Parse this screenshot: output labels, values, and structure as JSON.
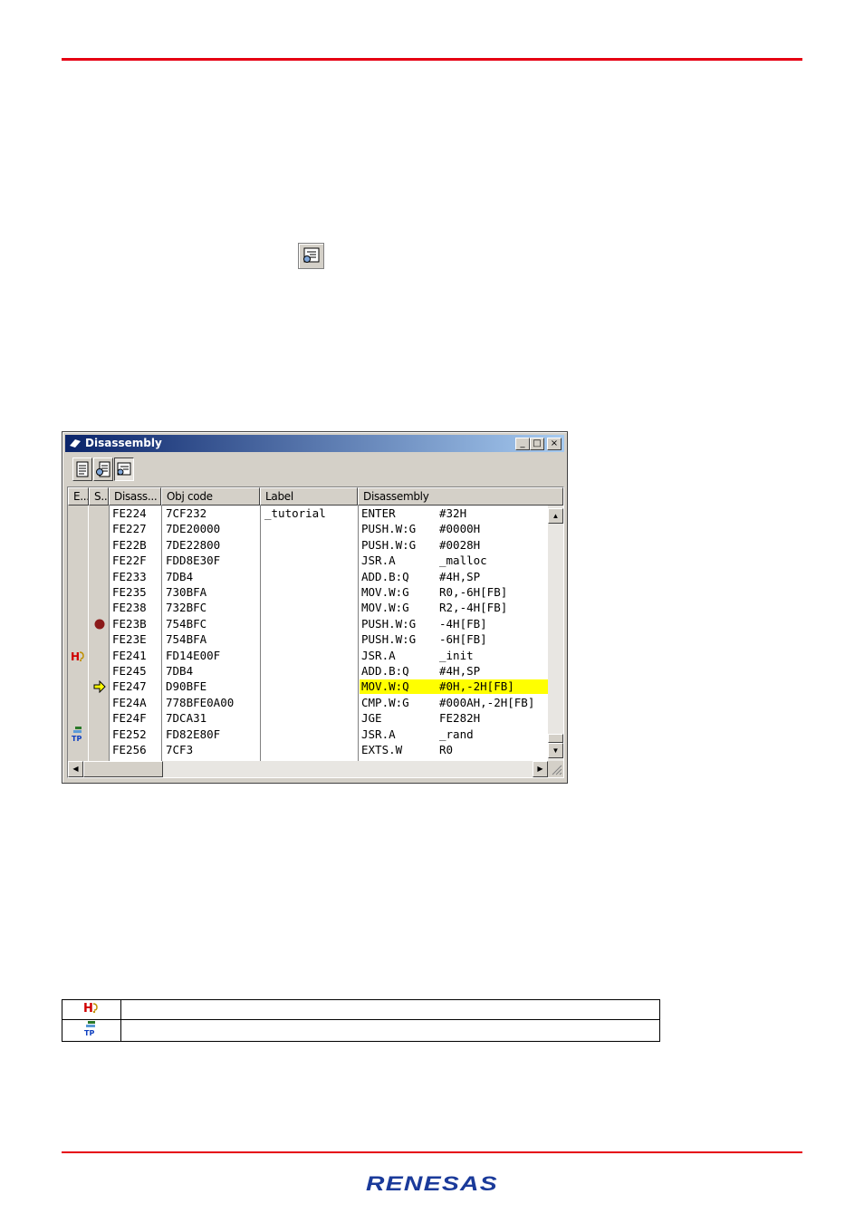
{
  "window": {
    "title": "Disassembly",
    "controls": {
      "minimize": "_",
      "maximize": "□",
      "close": "×"
    }
  },
  "toolbar": {
    "buttons": [
      {
        "icon": "source-view-icon",
        "pressed": false
      },
      {
        "icon": "mixed-view-icon",
        "pressed": false
      },
      {
        "icon": "disassembly-view-icon",
        "pressed": true
      }
    ]
  },
  "columns": [
    "E...",
    "S..",
    "Disass...",
    "Obj code",
    "Label",
    "Disassembly"
  ],
  "rows": [
    {
      "addr": "FE224",
      "obj": "7CF232",
      "label": "_tutorial",
      "mnemonic": "ENTER",
      "operand": "#32H"
    },
    {
      "addr": "FE227",
      "obj": "7DE20000",
      "label": "",
      "mnemonic": "PUSH.W:G",
      "operand": "#0000H"
    },
    {
      "addr": "FE22B",
      "obj": "7DE22800",
      "label": "",
      "mnemonic": "PUSH.W:G",
      "operand": "#0028H"
    },
    {
      "addr": "FE22F",
      "obj": "FDD8E30F",
      "label": "",
      "mnemonic": "JSR.A",
      "operand": "_malloc"
    },
    {
      "addr": "FE233",
      "obj": "7DB4",
      "label": "",
      "mnemonic": "ADD.B:Q",
      "operand": "#4H,SP"
    },
    {
      "addr": "FE235",
      "obj": "730BFA",
      "label": "",
      "mnemonic": "MOV.W:G",
      "operand": "R0,-6H[FB]"
    },
    {
      "addr": "FE238",
      "obj": "732BFC",
      "label": "",
      "mnemonic": "MOV.W:G",
      "operand": "R2,-4H[FB]"
    },
    {
      "addr": "FE23B",
      "obj": "754BFC",
      "label": "",
      "mnemonic": "PUSH.W:G",
      "operand": "-4H[FB]"
    },
    {
      "addr": "FE23E",
      "obj": "754BFA",
      "label": "",
      "mnemonic": "PUSH.W:G",
      "operand": "-6H[FB]"
    },
    {
      "addr": "FE241",
      "obj": "FD14E00F",
      "label": "",
      "mnemonic": "JSR.A",
      "operand": "_init"
    },
    {
      "addr": "FE245",
      "obj": "7DB4",
      "label": "",
      "mnemonic": "ADD.B:Q",
      "operand": "#4H,SP"
    },
    {
      "addr": "FE247",
      "obj": "D90BFE",
      "label": "",
      "mnemonic": "MOV.W:Q",
      "operand": "#0H,-2H[FB]"
    },
    {
      "addr": "FE24A",
      "obj": "778BFE0A00",
      "label": "",
      "mnemonic": "CMP.W:G",
      "operand": "#000AH,-2H[FB]"
    },
    {
      "addr": "FE24F",
      "obj": "7DCA31",
      "label": "",
      "mnemonic": "JGE",
      "operand": "FE282H"
    },
    {
      "addr": "FE252",
      "obj": "FD82E80F",
      "label": "",
      "mnemonic": "JSR.A",
      "operand": "_rand"
    },
    {
      "addr": "FE256",
      "obj": "7CF3",
      "label": "",
      "mnemonic": "EXTS.W",
      "operand": "R0"
    }
  ],
  "markers": {
    "breakpoint_row": 7,
    "pc_row": 11,
    "event_h_row": 9,
    "event_tp_row": 14
  },
  "colors": {
    "accent_red": "#e60012",
    "highlight": "#ffff00",
    "title_start": "#0a246a",
    "title_end": "#a6caf0",
    "breakpoint": "#8b1a1a"
  },
  "legend": [
    {
      "icon": "hardware-break-icon",
      "text": ""
    },
    {
      "icon": "trace-point-icon",
      "text": ""
    }
  ],
  "brand": "RENESAS"
}
